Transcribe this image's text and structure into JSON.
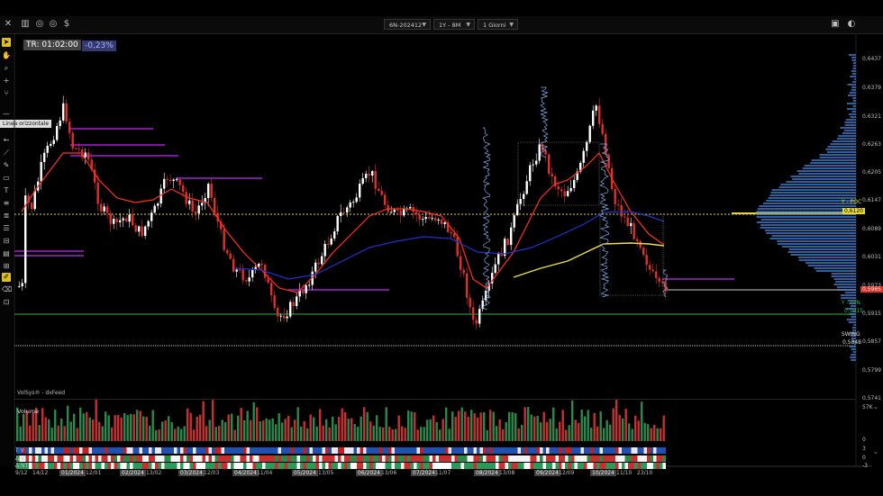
{
  "toolbar": {
    "close_glyph": "✕",
    "chart_glyph": "▥",
    "settings_glyph": "◎",
    "dollar_glyph": "$",
    "symbol": "6N-202412",
    "range": "1Y - 8M",
    "timeframe": "1 Giorni",
    "win_a": "▣",
    "win_b": "◐"
  },
  "tools": {
    "tooltip": "Linea orizzontale"
  },
  "header": {
    "tr_label": "TR: 01:02:00",
    "pct_label": "-0,23%"
  },
  "price_axis": [
    "0,6437",
    "0,6379",
    "0,6321",
    "0,6263",
    "0,6205",
    "0,6147",
    "0,6089",
    "0,6031",
    "0,5973",
    "0,5915",
    "0,5857",
    "0,5799",
    "0,5741"
  ],
  "price_tags": {
    "poc_label": "Y - POC",
    "poc_value": "0,6120",
    "current_value": "0,5965",
    "lvn_label": "Y - LVN",
    "lvn_value": "0,5915",
    "swing_label": "SWING",
    "swing_value": "0,5848"
  },
  "source_label": "VolSys® - dxFeed",
  "volume": {
    "title": "Volume",
    "axis_top": "57K",
    "axis_bottom": "0"
  },
  "indicators": {
    "rows": [
      "T V",
      "Δ V",
      "Δ NT"
    ],
    "axis": [
      "3",
      "0",
      "-3"
    ]
  },
  "dates": [
    {
      "label": "9/12",
      "hl": false
    },
    {
      "label": "14/12",
      "hl": false
    },
    {
      "label": "01/2024",
      "hl": true
    },
    {
      "label": "12/01",
      "hl": false
    },
    {
      "label": "02/2024",
      "hl": true
    },
    {
      "label": "13/02",
      "hl": false
    },
    {
      "label": "03/2024",
      "hl": true
    },
    {
      "label": "12/03",
      "hl": false
    },
    {
      "label": "04/2024",
      "hl": true
    },
    {
      "label": "11/04",
      "hl": false
    },
    {
      "label": "05/2024",
      "hl": true
    },
    {
      "label": "13/05",
      "hl": false
    },
    {
      "label": "06/2024",
      "hl": true
    },
    {
      "label": "13/06",
      "hl": false
    },
    {
      "label": "07/2024",
      "hl": true
    },
    {
      "label": "11/07",
      "hl": false
    },
    {
      "label": "08/2024",
      "hl": true
    },
    {
      "label": "13/08",
      "hl": false
    },
    {
      "label": "09/2024",
      "hl": true
    },
    {
      "label": "12/09",
      "hl": false
    },
    {
      "label": "10/2024",
      "hl": true
    },
    {
      "label": "11/10",
      "hl": false
    },
    {
      "label": "23/10",
      "hl": false
    }
  ],
  "colors": {
    "bull": "#ffffff",
    "bear": "#e0302a",
    "ma_fast": "#ff3020",
    "ma_mid": "#2030d0",
    "ma_slow": "#f0e040",
    "poc_line": "#e6d830",
    "lvn_line": "#30b040",
    "profile": "#3f7fd0",
    "level": "#7a1a9a"
  }
}
